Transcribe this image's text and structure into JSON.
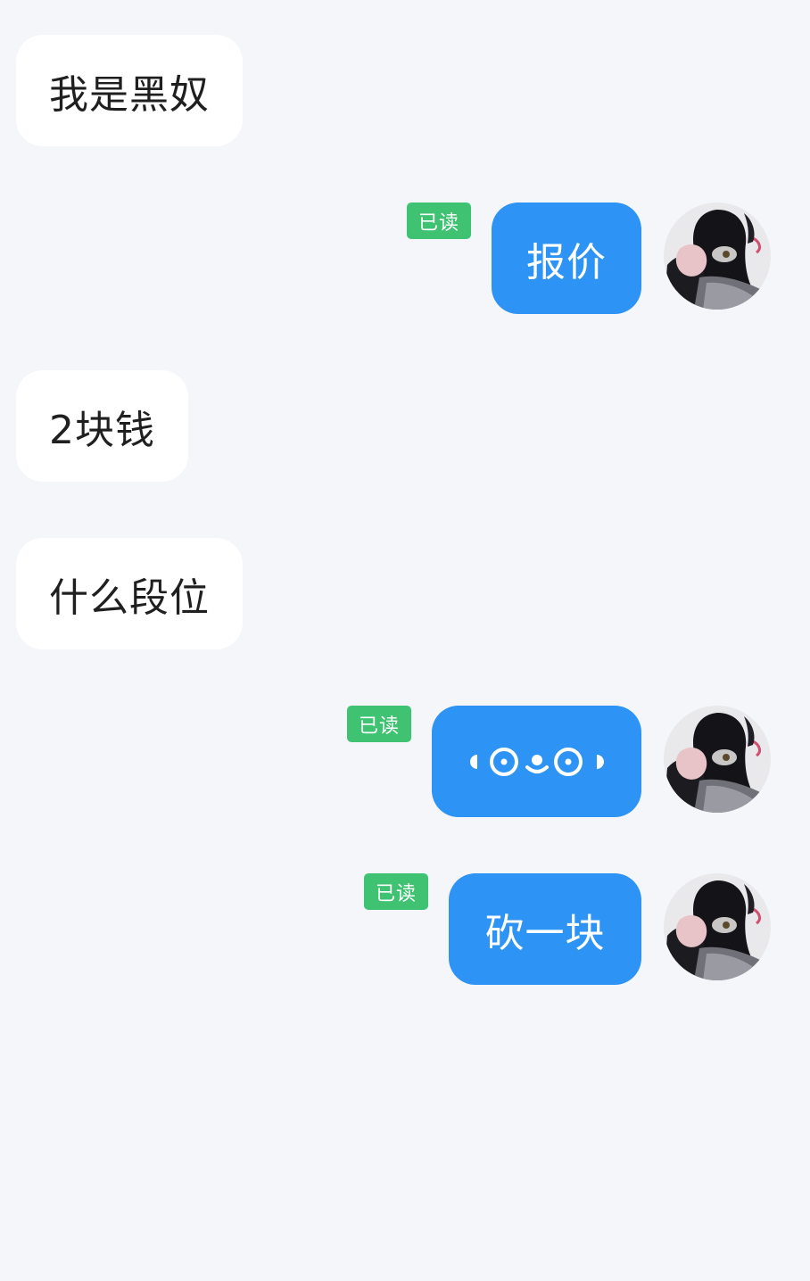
{
  "colors": {
    "background": "#f4f6f9",
    "incoming_bubble": "#ffffff",
    "outgoing_bubble": "#2d93f5",
    "read_badge": "#3fc373",
    "incoming_text": "#1f1f1f",
    "outgoing_text": "#ffffff"
  },
  "messages": [
    {
      "direction": "incoming",
      "text": "我是黑奴"
    },
    {
      "direction": "outgoing",
      "text": "报价",
      "read_status": "已读"
    },
    {
      "direction": "incoming",
      "text": "2块钱"
    },
    {
      "direction": "incoming",
      "text": "什么段位"
    },
    {
      "direction": "outgoing",
      "emoji": "face-emoji",
      "read_status": "已读"
    },
    {
      "direction": "outgoing",
      "text": "砍一块",
      "read_status": "已读"
    }
  ],
  "avatar": {
    "icon": "user-avatar"
  }
}
